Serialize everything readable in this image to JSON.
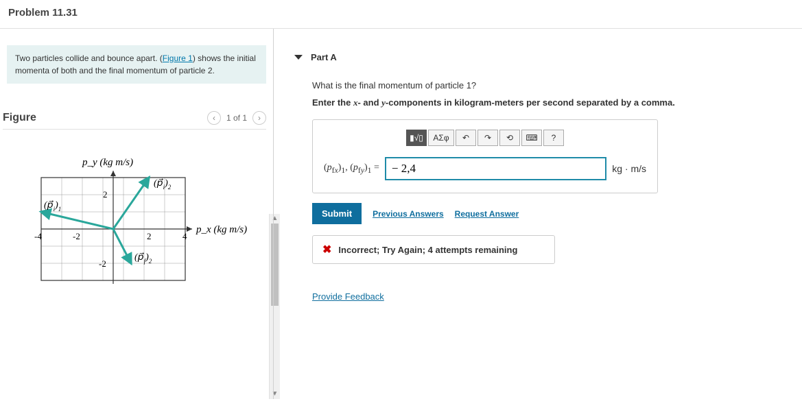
{
  "problem_title": "Problem 11.31",
  "prompt_html_pre": "Two particles collide and bounce apart. (",
  "prompt_link": "Figure 1",
  "prompt_html_post": ") shows the initial momenta of both and the final momentum of particle 2.",
  "figure": {
    "label": "Figure",
    "counter": "1 of 1",
    "y_axis": "p_y (kg m/s)",
    "x_axis": "p_x (kg m/s)",
    "x_ticks": [
      "-4",
      "-2",
      "2",
      "4"
    ],
    "y_ticks": [
      "2",
      "-2"
    ],
    "vectors": {
      "pi1": "(p⃗_i)_1",
      "pi2": "(p⃗_i)_2",
      "pf2": "(p⃗_f)_2"
    }
  },
  "part": {
    "label": "Part A",
    "question": "What is the final momentum of particle 1?",
    "hint_pre": "Enter the ",
    "hint_x": "x",
    "hint_mid": "- and ",
    "hint_y": "y",
    "hint_post": "-components in kilogram-meters per second separated by a comma.",
    "prefix": "(p_fx)_1, (p_fy)_1 =",
    "value": "− 2,4",
    "unit": "kg · m/s",
    "toolbar": {
      "tmpl": "▮√▯",
      "greek": "ΑΣφ",
      "undo": "↶",
      "redo": "↷",
      "reset": "⟲",
      "kbd": "⌨",
      "help": "?"
    }
  },
  "actions": {
    "submit": "Submit",
    "prev": "Previous Answers",
    "req": "Request Answer"
  },
  "feedback": {
    "text": "Incorrect; Try Again; 4 attempts remaining"
  },
  "provide": "Provide Feedback",
  "chart_data": {
    "type": "scatter",
    "title": "",
    "xlabel": "p_x (kg m/s)",
    "ylabel": "p_y (kg m/s)",
    "xlim": [
      -4,
      4
    ],
    "ylim": [
      -3,
      3
    ],
    "series": [
      {
        "name": "(p_i)_1",
        "vector_from": [
          0,
          0
        ],
        "vector_to": [
          -4,
          1
        ]
      },
      {
        "name": "(p_i)_2",
        "vector_from": [
          0,
          0
        ],
        "vector_to": [
          2,
          3
        ]
      },
      {
        "name": "(p_f)_2",
        "vector_from": [
          0,
          0
        ],
        "vector_to": [
          1,
          -2
        ]
      }
    ]
  }
}
